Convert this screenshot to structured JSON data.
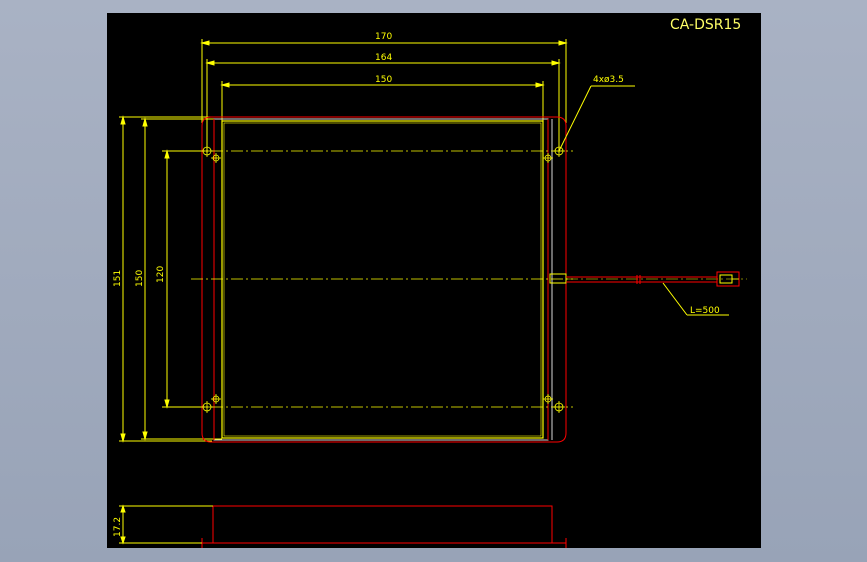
{
  "drawing": {
    "title": "CA-DSR15",
    "dimensions": {
      "overall_width": "170",
      "hole_spacing_width": "164",
      "panel_width": "150",
      "overall_height": "151",
      "panel_height": "150",
      "hole_spacing_height": "120",
      "thickness": "17.2"
    },
    "hole_callout": "4xø3.5",
    "cable_callout": "L=500"
  },
  "colors": {
    "background": "#000000",
    "dimension": "#ffff00",
    "outline": "#ff0000",
    "frame": "#d8d8d8"
  }
}
